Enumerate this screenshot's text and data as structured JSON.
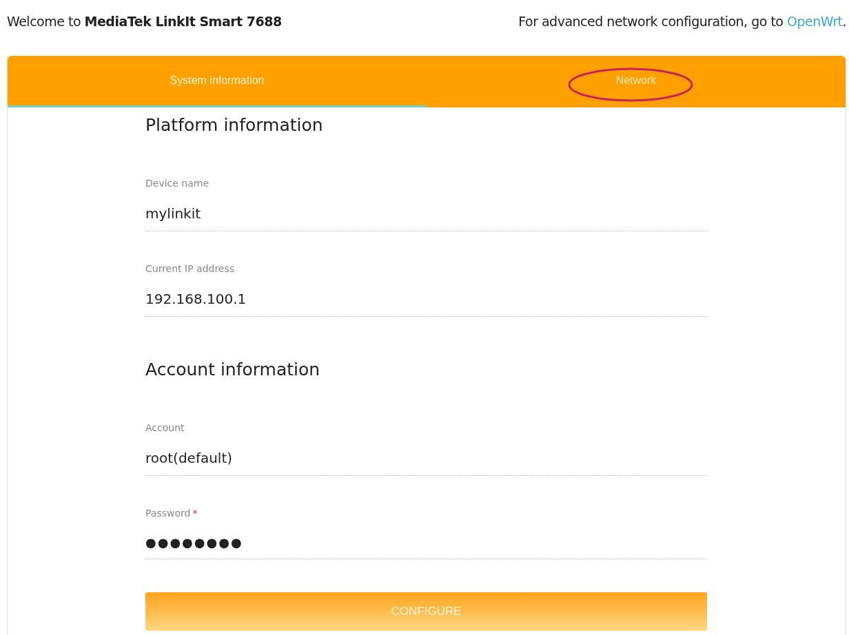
{
  "header": {
    "welcome": "Welcome to **MediaTek LinkIt Smart 7688**",
    "advanced_text": "For advanced network configuration, go to ",
    "advanced_link": "OpenWrt",
    "advanced_end": "."
  },
  "tabs": [
    {
      "label": "System information",
      "selected": true,
      "highlighted": false
    },
    {
      "label": "Network",
      "selected": false,
      "highlighted": true
    }
  ],
  "sections": [
    {
      "title": "Platform information",
      "fields": [
        {
          "label": "Device name",
          "value": "mylinkit"
        },
        {
          "label": "Current IP address",
          "value": "192.168.100.1"
        }
      ]
    },
    {
      "title": "Account information",
      "fields": [
        {
          "label": "Account",
          "value": "root(default)"
        },
        {
          "label": "Password",
          "required_mark": "*",
          "value": "●●●●●●●●",
          "kind": "password"
        }
      ]
    }
  ],
  "button": "CONFIGURE"
}
